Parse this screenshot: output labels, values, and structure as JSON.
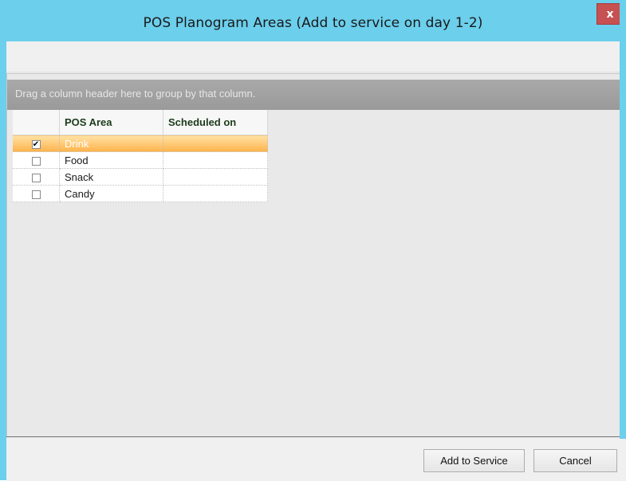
{
  "window": {
    "title": "POS Planogram Areas (Add to service on day 1-2)",
    "close_label": "x"
  },
  "grid": {
    "group_hint": "Drag a column header here to group by that column.",
    "columns": [
      "POS Area",
      "Scheduled on"
    ],
    "rows": [
      {
        "checked": true,
        "area": "Drink",
        "scheduled": ""
      },
      {
        "checked": false,
        "area": "Food",
        "scheduled": ""
      },
      {
        "checked": false,
        "area": "Snack",
        "scheduled": ""
      },
      {
        "checked": false,
        "area": "Candy",
        "scheduled": ""
      }
    ],
    "selected_row": 0
  },
  "footer": {
    "add_label": "Add to Service",
    "cancel_label": "Cancel"
  },
  "colors": {
    "titlebar": "#6ccfec",
    "selection": "#ffb24a",
    "close": "#c75050"
  },
  "icons": {
    "close": "close-icon",
    "checkbox": "checkbox-icon"
  }
}
